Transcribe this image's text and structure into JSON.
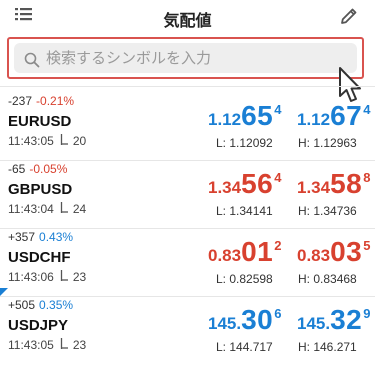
{
  "header": {
    "title": "気配値"
  },
  "search": {
    "placeholder": "検索するシンボルを入力"
  },
  "colors": {
    "up": "#1a7fd4",
    "down": "#d8412f",
    "highlight_border": "#d9534f"
  },
  "quotes": [
    {
      "change": "-237",
      "change_pct": "-0.21%",
      "direction": "down",
      "symbol": "EURUSD",
      "time": "11:43:05",
      "spread": "20",
      "bid": {
        "big": "1.12",
        "main": "65",
        "small": "4"
      },
      "ask": {
        "big": "1.12",
        "main": "67",
        "small": "4"
      },
      "low": "L: 1.12092",
      "high": "H: 1.12963",
      "color": "blue"
    },
    {
      "change": "-65",
      "change_pct": "-0.05%",
      "direction": "down",
      "symbol": "GBPUSD",
      "time": "11:43:04",
      "spread": "24",
      "bid": {
        "big": "1.34",
        "main": "56",
        "small": "4"
      },
      "ask": {
        "big": "1.34",
        "main": "58",
        "small": "8"
      },
      "low": "L: 1.34141",
      "high": "H: 1.34736",
      "color": "red"
    },
    {
      "change": "+357",
      "change_pct": "0.43%",
      "direction": "up",
      "symbol": "USDCHF",
      "time": "11:43:06",
      "spread": "23",
      "bid": {
        "big": "0.83",
        "main": "01",
        "small": "2"
      },
      "ask": {
        "big": "0.83",
        "main": "03",
        "small": "5"
      },
      "low": "L: 0.82598",
      "high": "H: 0.83468",
      "color": "red"
    },
    {
      "change": "+505",
      "change_pct": "0.35%",
      "direction": "up",
      "symbol": "USDJPY",
      "time": "11:43:05",
      "spread": "23",
      "bid": {
        "big": "145.",
        "main": "30",
        "small": "6"
      },
      "ask": {
        "big": "145.",
        "main": "32",
        "small": "9"
      },
      "low": "L: 144.717",
      "high": "H: 146.271",
      "color": "blue"
    }
  ]
}
